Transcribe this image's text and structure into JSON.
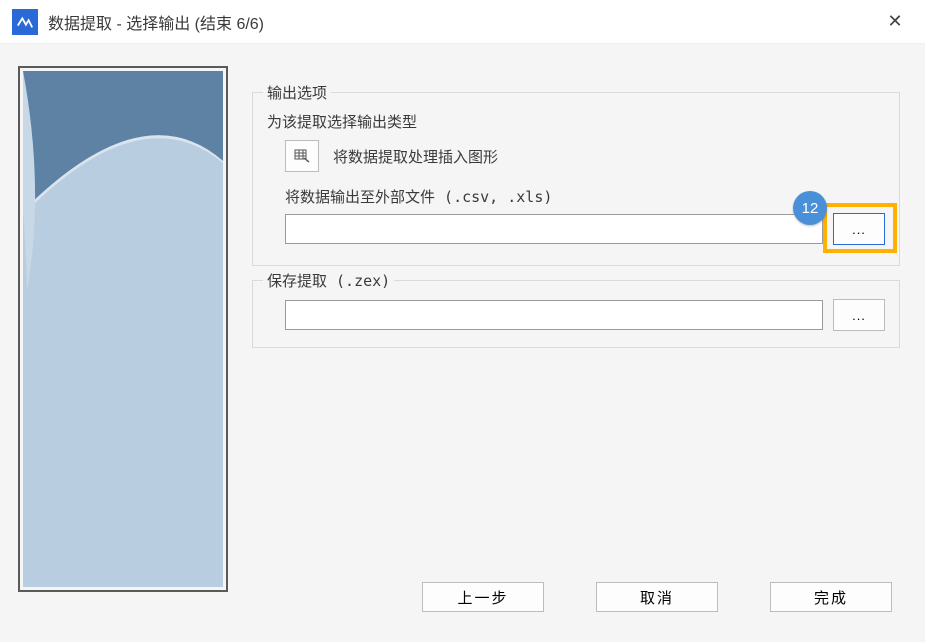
{
  "titlebar": {
    "title": "数据提取 - 选择输出 (结束 6/6)",
    "close_glyph": "✕"
  },
  "output_options": {
    "group_title": "输出选项",
    "subtitle": "为该提取选择输出类型",
    "insert_graphic_label": "将数据提取处理插入图形",
    "external_file_label": "将数据输出至外部文件 (.csv, .xls)",
    "external_file_value": "",
    "browse_label": "..."
  },
  "save_extraction": {
    "group_title": "保存提取 (.zex)",
    "path_value": "",
    "browse_label": "..."
  },
  "step_badge": "12",
  "footer": {
    "back": "上一步",
    "cancel": "取消",
    "finish": "完成"
  }
}
